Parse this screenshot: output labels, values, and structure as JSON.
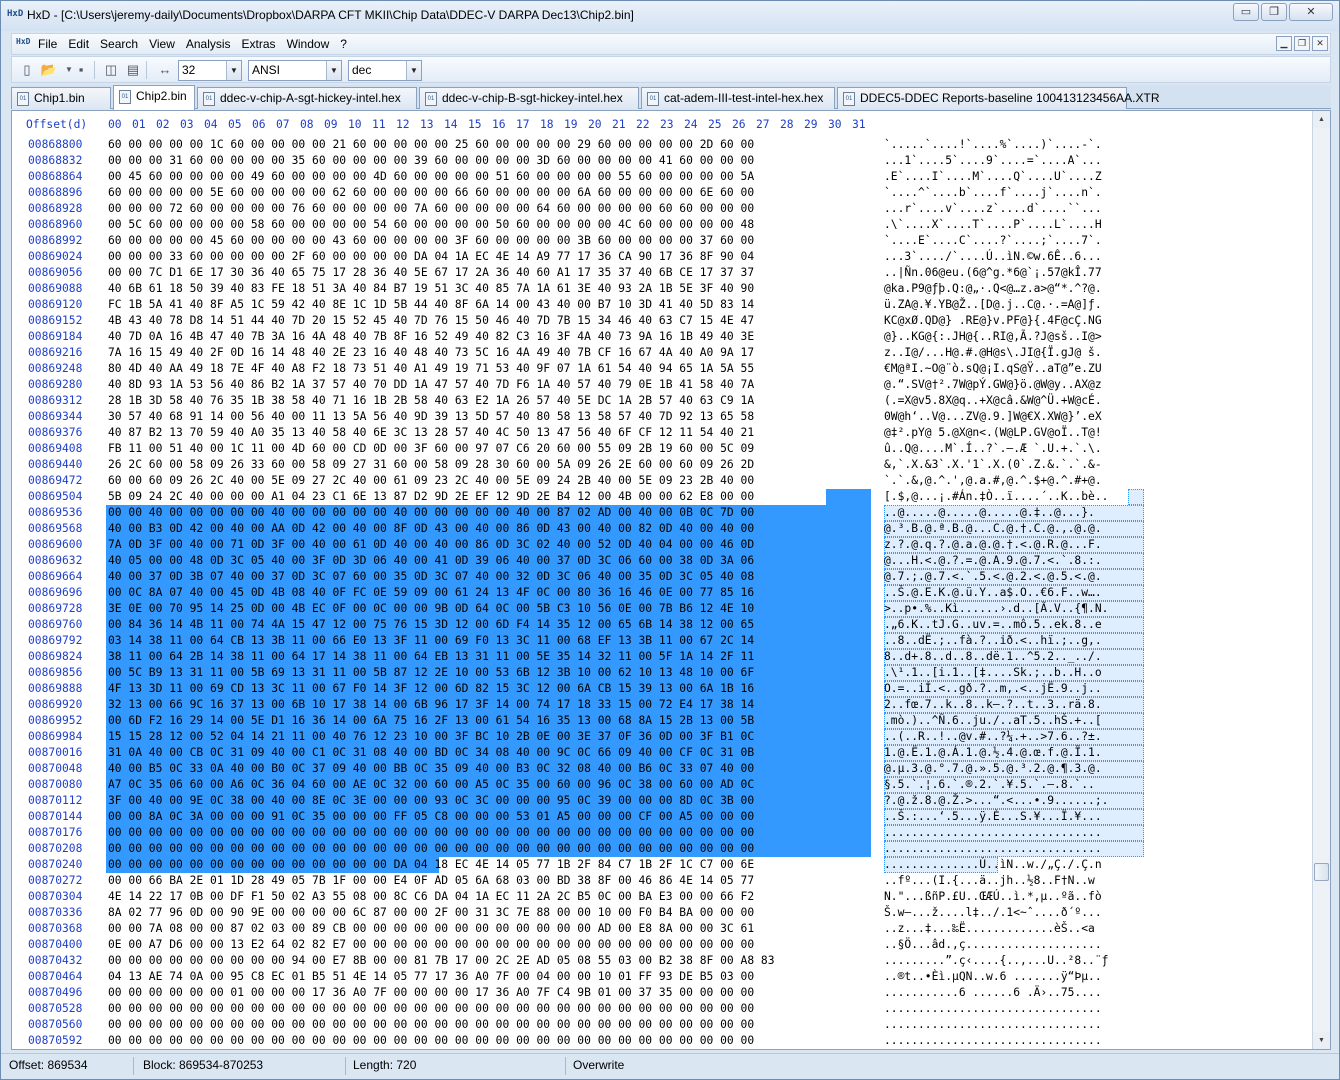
{
  "window": {
    "app_icon": "HxD",
    "title": "HxD - [C:\\Users\\jeremy-daily\\Documents\\Dropbox\\DARPA CFT MKII\\Chip Data\\DDEC-V DARPA Dec13\\Chip2.bin]",
    "minimize_label": "▭",
    "maximize_label": "❐",
    "close_label": "✕"
  },
  "menu": {
    "items": [
      "File",
      "Edit",
      "Search",
      "View",
      "Analysis",
      "Extras",
      "Window",
      "?"
    ],
    "mdi_minimize": "▁",
    "mdi_restore": "❐",
    "mdi_close": "✕"
  },
  "toolbar": {
    "icons": [
      "new-file-icon",
      "open-file-icon",
      "save-icon",
      "open-disk-icon",
      "open-ram-icon",
      "bytes-per-row-icon"
    ],
    "bytes_per_row": "32",
    "charset": "ANSI",
    "offset_base": "dec"
  },
  "tabs": [
    {
      "label": "Chip1.bin",
      "active": false
    },
    {
      "label": "Chip2.bin",
      "active": true
    },
    {
      "label": "ddec-v-chip-A-sgt-hickey-intel.hex",
      "active": false
    },
    {
      "label": "ddec-v-chip-B-sgt-hickey-intel.hex",
      "active": false
    },
    {
      "label": "cat-adem-III-test-intel-hex.hex",
      "active": false
    },
    {
      "label": "DDEC5-DDEC Reports-baseline 100413123456AA.XTR",
      "active": false
    }
  ],
  "hex": {
    "offset_header": "Offset(d)",
    "columns": [
      "00",
      "01",
      "02",
      "03",
      "04",
      "05",
      "06",
      "07",
      "08",
      "09",
      "10",
      "11",
      "12",
      "13",
      "14",
      "15",
      "16",
      "17",
      "18",
      "19",
      "20",
      "21",
      "22",
      "23",
      "24",
      "25",
      "26",
      "27",
      "28",
      "29",
      "30",
      "31"
    ],
    "selection_color": "#3399ff",
    "rows": [
      {
        "offset": "00868800",
        "bytes": "60 00 00 00 00 1C 60 00 00 00 00 21 60 00 00 00 00 25 60 00 00 00 00 29 60 00 00 00 00 2D 60 00",
        "text": "`.....`....!`....%`....)`....-`."
      },
      {
        "offset": "00868832",
        "bytes": "00 00 00 31 60 00 00 00 00 35 60 00 00 00 00 39 60 00 00 00 00 3D 60 00 00 00 00 41 60 00 00 00",
        "text": "...1`....5`....9`....=`....A`..."
      },
      {
        "offset": "00868864",
        "bytes": "00 45 60 00 00 00 00 49 60 00 00 00 00 4D 60 00 00 00 00 51 60 00 00 00 00 55 60 00 00 00 00 5A",
        "text": ".E`....I`....M`....Q`....U`....Z"
      },
      {
        "offset": "00868896",
        "bytes": "60 00 00 00 00 5E 60 00 00 00 00 62 60 00 00 00 00 66 60 00 00 00 00 6A 60 00 00 00 00 6E 60 00",
        "text": "`....^`....b`....f`....j`....n`."
      },
      {
        "offset": "00868928",
        "bytes": "00 00 00 72 60 00 00 00 00 76 60 00 00 00 00 7A 60 00 00 00 00 64 60 00 00 00 00 60 60 00 00 00",
        "text": "...r`....v`....z`....d`....``..."
      },
      {
        "offset": "00868960",
        "bytes": "00 5C 60 00 00 00 00 58 60 00 00 00 00 54 60 00 00 00 00 50 60 00 00 00 00 4C 60 00 00 00 00 48",
        "text": ".\\`....X`....T`....P`....L`....H"
      },
      {
        "offset": "00868992",
        "bytes": "60 00 00 00 00 45 60 00 00 00 00 43 60 00 00 00 00 3F 60 00 00 00 00 3B 60 00 00 00 00 37 60 00",
        "text": "`....E`....C`....?`....;`....7`."
      },
      {
        "offset": "00869024",
        "bytes": "00 00 00 33 60 00 00 00 00 2F 60 00 00 00 00 DA 04 1A EC 4E 14 A9 77 17 36 CA 90 17 36 8F 90 04",
        "text": "...3`..../`....Ú..ìN.©w.6Ê..6..."
      },
      {
        "offset": "00869056",
        "bytes": "00 00 7C D1 6E 17 30 36 40 65 75 17 28 36 40 5E 67 17 2A 36 40 60 A1 17 35 37 40 6B CE 17 37 37",
        "text": "..|Ñn.06@eu.(6@^g.*6@`¡.57@kÎ.77"
      },
      {
        "offset": "00869088",
        "bytes": "40 6B 61 18 50 39 40 83 FE 18 51 3A 40 84 B7 19 51 3C 40 85 7A 1A 61 3E 40 93 2A 1B 5E 3F 40 90",
        "text": "@ka.P9@ƒþ.Q:@„·.Q<@…z.a>@“*.^?@."
      },
      {
        "offset": "00869120",
        "bytes": "FC 1B 5A 41 40 8F A5 1C 59 42 40 8E 1C 1D 5B 44 40 8F 6A 14 00 43 40 00 B7 10 3D 41 40 5D 83 14",
        "text": "ü.ZA@.¥.YB@Ž..[D@.j..C@.·.=A@]ƒ."
      },
      {
        "offset": "00869152",
        "bytes": "4B 43 40 78 D8 14 51 44 40 7D 20 15 52 45 40 7D 76 15 50 46 40 7D 7B 15 34 46 40 63 C7 15 4E 47",
        "text": "KC@xØ.QD@} .RE@}v.PF@}{.4F@cÇ.NG"
      },
      {
        "offset": "00869184",
        "bytes": "40 7D 0A 16 4B 47 40 7B 3A 16 4A 48 40 7B 8F 16 52 49 40 82 C3 16 3F 4A 40 73 9A 16 1B 49 40 3E",
        "text": "@}..KG@{:.JH@{..RI@‚Ã.?J@sš..I@>"
      },
      {
        "offset": "00869216",
        "bytes": "7A 16 15 49 40 2F 0D 16 14 48 40 2E 23 16 40 48 40 73 5C 16 4A 49 40 7B CF 16 67 4A 40 A0 9A 17",
        "text": "z..I@/...H@.#.@H@s\\.JI@{Ï.gJ@ š."
      },
      {
        "offset": "00869248",
        "bytes": "80 4D 40 AA 49 18 7E 4F 40 A8 F2 18 73 51 40 A1 49 19 71 53 40 9F 07 1A 61 54 40 94 65 1A 5A 55",
        "text": "€M@ªI.~O@¨ò.sQ@¡I.qS@Ÿ..aT@”e.ZU"
      },
      {
        "offset": "00869280",
        "bytes": "40 8D 93 1A 53 56 40 86 B2 1A 37 57 40 70 DD 1A 47 57 40 7D F6 1A 40 57 40 79 0E 1B 41 58 40 7A",
        "text": "@.“.SV@†².7W@pÝ.GW@}ö.@W@y..AX@z"
      },
      {
        "offset": "00869312",
        "bytes": "28 1B 3D 58 40 76 35 1B 38 58 40 71 16 1B 2B 58 40 63 E2 1A 26 57 40 5E DC 1A 2B 57 40 63 C9 1A",
        "text": "(.=X@v5.8X@q..+X@câ.&W@^Ü.+W@cÉ."
      },
      {
        "offset": "00869344",
        "bytes": "30 57 40 68 91 14 00 56 40 00 11 13 5A 56 40 9D 39 13 5D 57 40 80 58 13 58 57 40 7D 92 13 65 58",
        "text": "0W@h‘..V@...ZV@.9.]W@€X.XW@}’.eX"
      },
      {
        "offset": "00869376",
        "bytes": "40 87 B2 13 70 59 40 A0 35 13 40 58 40 6E 3C 13 28 57 40 4C 50 13 47 56 40 6F CF 12 11 54 40 21",
        "text": "@‡².pY@ 5.@X@n<.(W@LP.GV@oÏ..T@!"
      },
      {
        "offset": "00869408",
        "bytes": "FB 11 00 51 40 00 1C 11 00 4D 60 00 CD 0D 00 3F 60 00 97 07 C6 20 60 00 55 09 2B 19 60 00 5C 09",
        "text": "û..Q@....M`.Í..?`.—.Æ `.U.+.`.\\."
      },
      {
        "offset": "00869440",
        "bytes": "26 2C 60 00 58 09 26 33 60 00 58 09 27 31 60 00 58 09 28 30 60 00 5A 09 26 2E 60 00 60 09 26 2D",
        "text": "&,`.X.&3`.X.'1`.X.(0`.Z.&.`.`.&-"
      },
      {
        "offset": "00869472",
        "bytes": "60 00 60 09 26 2C 40 00 5E 09 27 2C 40 00 61 09 23 2C 40 00 5E 09 24 2B 40 00 5E 09 23 2B 40 00",
        "text": "`.`.&,@.^.',@.a.#,@.^.$+@.^.#+@."
      },
      {
        "offset": "00869504",
        "bytes": "5B 09 24 2C 40 00 00 00 A1 04 23 C1 6E 13 87 D2 9D 2E EF 12 9D 2E B4 12 00 4B 00 00 62 E8 00 00",
        "text": "[.$,@...¡.#Án.‡Ò..ï....´..K..bè..",
        "sel_from": 30
      },
      {
        "offset": "00869536",
        "bytes": "00 00 40 00 00 00 00 00 40 00 00 00 00 00 40 00 00 00 00 00 40 00 87 02 AD 00 40 00 0B 0C 7D 00",
        "text": "..@.....@.....@.....@.‡.­.@...}.",
        "sel_from": 0
      },
      {
        "offset": "00869568",
        "bytes": "40 00 B3 0D 42 00 40 00 AA 0D 42 00 40 00 8F 0D 43 00 40 00 86 0D 43 00 40 00 82 0D 40 00 40 00",
        "text": "@.³.B.@.ª.B.@...C.@.†.C.@.‚.@.@.",
        "sel_from": 0
      },
      {
        "offset": "00869600",
        "bytes": "7A 0D 3F 00 40 00 71 0D 3F 00 40 00 61 0D 40 00 40 00 86 0D 3C 02 40 00 52 0D 40 04 00 00 46 0D",
        "text": "z.?.@.q.?.@.a.@.@.†.<.@.R.@...F.",
        "sel_from": 0
      },
      {
        "offset": "00869632",
        "bytes": "40 05 00 00 48 0D 3C 05 40 00 3F 0D 3D 06 40 00 41 0D 39 06 40 00 37 0D 3C 06 60 00 38 0D 3A 06",
        "text": "@...H.<.@.?.=.@.A.9.@.7.<.`.8.:.",
        "sel_from": 0
      },
      {
        "offset": "00869664",
        "bytes": "40 00 37 0D 3B 07 40 00 37 0D 3C 07 60 00 35 0D 3C 07 40 00 32 0D 3C 06 40 00 35 0D 3C 05 40 08",
        "text": "@.7.;.@.7.<.`.5.<.@.2.<.@.5.<.@.",
        "sel_from": 0
      },
      {
        "offset": "00869696",
        "bytes": "00 0C 8A 07 40 00 45 0D 4B 08 40 0F FC 0E 59 09 00 61 24 13 4F 0C 00 80 36 16 46 0E 00 77 85 16",
        "text": "..Š.@.E.K.@.ü.Y..a$.O..€6.F..w….",
        "sel_from": 0
      },
      {
        "offset": "00869728",
        "bytes": "3E 0E 00 70 95 14 25 0D 00 4B EC 0F 00 0C 00 00 9B 0D 64 0C 00 5B C3 10 56 0E 00 7B B6 12 4E 10",
        "text": ">..p•.%..Kì......›.d..[Ã.V..{¶.N.",
        "sel_from": 0
      },
      {
        "offset": "00869760",
        "bytes": "00 84 36 14 4B 11 00 74 4A 15 47 12 00 75 76 15 3D 12 00 6D F4 14 35 12 00 65 6B 14 38 12 00 65",
        "text": ".„6.K..tJ.G..uv.=..mô.5..ek.8..e",
        "sel_from": 0
      },
      {
        "offset": "00869792",
        "bytes": "03 14 38 11 00 64 CB 13 3B 11 00 66 E0 13 3F 11 00 69 F0 13 3C 11 00 68 EF 13 3B 11 00 67 2C 14",
        "text": "..8..dË.;..fà.?..ið.<..hï.;..g,.",
        "sel_from": 0
      },
      {
        "offset": "00869824",
        "bytes": "38 11 00 64 2B 14 38 11 00 64 17 14 38 11 00 64 EB 13 31 11 00 5E 35 14 32 11 00 5F 1A 14 2F 11",
        "text": "8..d+.8..d..8..dë.1..^5.2.._../.",
        "sel_from": 0
      },
      {
        "offset": "00869856",
        "bytes": "00 5C B9 13 31 11 00 5B 69 13 31 11 00 5B 87 12 2E 10 00 53 6B 12 3B 10 00 62 10 13 48 10 00 6F",
        "text": ".\\¹.1..[i.1..[‡....Sk.;..b..H..o",
        "sel_from": 0
      },
      {
        "offset": "00869888",
        "bytes": "4F 13 3D 11 00 69 CD 13 3C 11 00 67 F0 14 3F 12 00 6D 82 15 3C 12 00 6A CB 15 39 13 00 6A 1B 16",
        "text": "O.=..iÍ.<..gð.?..m‚.<..jË.9..j..",
        "sel_from": 0
      },
      {
        "offset": "00869920",
        "bytes": "32 13 00 66 9C 16 37 13 00 6B 10 17 38 14 00 6B 96 17 3F 14 00 74 17 18 33 15 00 72 E4 17 38 14",
        "text": "2..fœ.7..k..8..k–.?..t..3..rä.8.",
        "sel_from": 0
      },
      {
        "offset": "00869952",
        "bytes": "00 6D F2 16 29 14 00 5E D1 16 36 14 00 6A 75 16 2F 13 00 61 54 16 35 13 00 68 8A 15 2B 13 00 5B",
        "text": ".mò.)..^Ñ.6..ju./..aT.5..hŠ.+..[",
        "sel_from": 0
      },
      {
        "offset": "00869984",
        "bytes": "15 15 28 12 00 52 04 14 21 11 00 40 76 12 23 10 00 3F BC 10 2B 0E 00 3E 37 0F 36 0D 00 3F B1 0C",
        "text": "..(..R..!..@v.#..?¼.+..>7.6..?±.",
        "sel_from": 0
      },
      {
        "offset": "00870016",
        "bytes": "31 0A 40 00 CB 0C 31 09 40 00 C1 0C 31 08 40 00 BD 0C 34 08 40 00 9C 0C 66 09 40 00 CF 0C 31 0B",
        "text": "1.@.Ë.1.@.Á.1.@.½.4.@.œ.f.@.Ï.1.",
        "sel_from": 0
      },
      {
        "offset": "00870048",
        "bytes": "40 00 B5 0C 33 0A 40 00 B0 0C 37 09 40 00 BB 0C 35 09 40 00 B3 0C 32 08 40 00 B6 0C 33 07 40 00",
        "text": "@.µ.3.@.°.7.@.».5.@.³.2.@.¶.3.@.",
        "sel_from": 0
      },
      {
        "offset": "00870080",
        "bytes": "A7 0C 35 06 60 00 A6 0C 36 04 60 00 AE 0C 32 00 60 00 A5 0C 35 00 60 00 96 0C 38 00 60 00 AD 0C",
        "text": "§.5.`.¦.6.`.®.2.`.¥.5.`.–.8.`.­.",
        "sel_from": 0
      },
      {
        "offset": "00870112",
        "bytes": "3F 00 40 00 9E 0C 38 00 40 00 8E 0C 3E 00 00 00 93 0C 3C 00 00 00 95 0C 39 00 00 00 8D 0C 3B 00",
        "text": "?.@.ž.8.@.Ž.>...“.<...•.9......;.",
        "sel_from": 0
      },
      {
        "offset": "00870144",
        "bytes": "00 00 8A 0C 3A 00 00 00 91 0C 35 00 00 00 FF 05 C8 00 00 00 53 01 A5 00 00 00 CF 00 A5 00 00 00",
        "text": "..Š.:...‘.5...ÿ.È...S.¥...Ï.¥...",
        "sel_from": 0
      },
      {
        "offset": "00870176",
        "bytes": "00 00 00 00 00 00 00 00 00 00 00 00 00 00 00 00 00 00 00 00 00 00 00 00 00 00 00 00 00 00 00 00",
        "text": "................................",
        "sel_from": 0
      },
      {
        "offset": "00870208",
        "bytes": "00 00 00 00 00 00 00 00 00 00 00 00 00 00 00 00 00 00 00 00 00 00 00 00 00 00 00 00 00 00 00 00",
        "text": "................................",
        "sel_from": 0
      },
      {
        "offset": "00870240",
        "bytes": "00 00 00 00 00 00 00 00 00 00 00 00 00 00 DA 04 18 EC 4E 14 05 77 1B 2F 84 C7 1B 2F 1C C7 00 6E",
        "text": "..............Ú..ìN..w./„Ç./.Ç.n",
        "sel_from": 0,
        "sel_to": 14
      },
      {
        "offset": "00870272",
        "bytes": "00 00 66 BA 2E 01 1D 28 49 05 7B 1F 00 00 E4 0F AD 05 6A 68 03 00 BD 38 8F 00 46 86 4E 14 05 77",
        "text": "..fº...(I.{...ä.­.jh..½8..F†N..w"
      },
      {
        "offset": "00870304",
        "bytes": "4E 14 22 17 0B 00 DF F1 50 02 A3 55 08 00 8C C6 DA 04 1A EC 11 2A 2C B5 0C 00 BA E3 00 00 66 F2",
        "text": "N.\"...ßñP.£U..ŒÆÚ..ì.*,µ..ºã..fò"
      },
      {
        "offset": "00870336",
        "bytes": "8A 02 77 96 0D 00 90 9E 00 00 00 00 6C 87 00 00 2F 00 31 3C 7E 88 00 00 10 00 F0 B4 BA 00 00 00",
        "text": "Š.w–...ž....l‡../.1<~ˆ....ð´º..."
      },
      {
        "offset": "00870368",
        "bytes": "00 00 7A 08 00 00 87 02 03 00 89 CB 00 00 00 00 00 00 00 00 00 00 00 00 AD 00 E8 8A 00 00 3C 61",
        "text": "..z...‡...‰Ë............­.èŠ..<a"
      },
      {
        "offset": "00870400",
        "bytes": "0E 00 A7 D6 00 00 13 E2 64 02 82 E7 00 00 00 00 00 00 00 00 00 00 00 00 00 00 00 00 00 00 00 00",
        "text": "..§Ö...âd.‚ç...................."
      },
      {
        "offset": "00870432",
        "bytes": "00 00 00 00 00 00 00 00 00 94 00 E7 8B 00 00 81 7B 17 00 2C 2E AD 05 08 55 03 00 B2 38 8F 00 A8 83",
        "text": ".........”.ç‹....{..,.­..U..²8..¨ƒ"
      },
      {
        "offset": "00870464",
        "bytes": "04 13 AE 74 0A 00 95 C8 EC 01 B5 51 4E 14 05 77 17 36 A0 7F 00 04 00 00 10 01 FF 93 DE B5 03 00",
        "text": "..®t..•Èì.µQN..w.6 .......ÿ“Þµ.."
      },
      {
        "offset": "00870496",
        "bytes": "00 00 00 00 00 00 01 00 00 00 17 36 A0 7F 00 00 00 00 17 36 A0 7F C4 9B 01 00 37 35 00 00 00 00",
        "text": "...........6 ......6 .Ä›..75...."
      },
      {
        "offset": "00870528",
        "bytes": "00 00 00 00 00 00 00 00 00 00 00 00 00 00 00 00 00 00 00 00 00 00 00 00 00 00 00 00 00 00 00 00",
        "text": "................................"
      },
      {
        "offset": "00870560",
        "bytes": "00 00 00 00 00 00 00 00 00 00 00 00 00 00 00 00 00 00 00 00 00 00 00 00 00 00 00 00 00 00 00 00",
        "text": "................................"
      },
      {
        "offset": "00870592",
        "bytes": "00 00 00 00 00 00 00 00 00 00 00 00 00 00 00 00 00 00 00 00 00 00 00 00 00 00 00 00 00 00 00 00",
        "text": "................................"
      }
    ]
  },
  "status": {
    "offset": "Offset: 869534",
    "block": "Block: 869534-870253",
    "length": "Length: 720",
    "mode": "Overwrite"
  }
}
